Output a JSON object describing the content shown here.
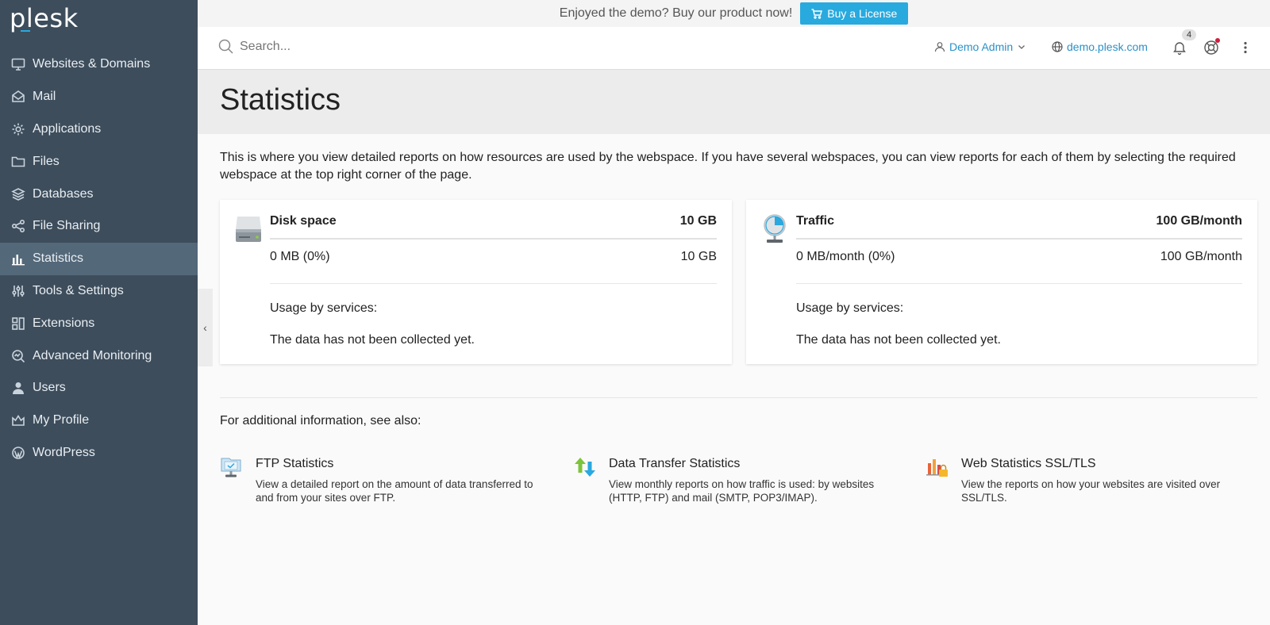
{
  "brand": {
    "logo": "plesk"
  },
  "sidebar": {
    "items": [
      {
        "label": "Websites & Domains",
        "icon": "monitor-icon",
        "active": false
      },
      {
        "label": "Mail",
        "icon": "mail-icon",
        "active": false
      },
      {
        "label": "Applications",
        "icon": "gear-icon",
        "active": false
      },
      {
        "label": "Files",
        "icon": "folder-icon",
        "active": false
      },
      {
        "label": "Databases",
        "icon": "layers-icon",
        "active": false
      },
      {
        "label": "File Sharing",
        "icon": "share-icon",
        "active": false
      },
      {
        "label": "Statistics",
        "icon": "bar-chart-icon",
        "active": true
      },
      {
        "label": "Tools & Settings",
        "icon": "sliders-icon",
        "active": false
      },
      {
        "label": "Extensions",
        "icon": "extensions-icon",
        "active": false
      },
      {
        "label": "Advanced Monitoring",
        "icon": "monitoring-icon",
        "active": false
      },
      {
        "label": "Users",
        "icon": "user-icon",
        "active": false
      },
      {
        "label": "My Profile",
        "icon": "crown-icon",
        "active": false
      },
      {
        "label": "WordPress",
        "icon": "wordpress-icon",
        "active": false
      }
    ]
  },
  "banner": {
    "text": "Enjoyed the demo? Buy our product now!",
    "button": "Buy a License"
  },
  "header": {
    "search_placeholder": "Search...",
    "user": "Demo Admin",
    "domain": "demo.plesk.com",
    "notifications_count": "4"
  },
  "page": {
    "title": "Statistics",
    "intro": "This is where you view detailed reports on how resources are used by the webspace. If you have several webspaces, you can view reports for each of them by selecting the required webspace at the top right corner of the page."
  },
  "cards": {
    "disk": {
      "title": "Disk space",
      "limit": "10 GB",
      "used": "0 MB (0%)",
      "used_limit": "10 GB",
      "usage_label": "Usage by services:",
      "no_data": "The data has not been collected yet."
    },
    "traffic": {
      "title": "Traffic",
      "limit": "100 GB/month",
      "used": "0 MB/month (0%)",
      "used_limit": "100 GB/month",
      "usage_label": "Usage by services:",
      "no_data": "The data has not been collected yet."
    }
  },
  "see_also": {
    "label": "For additional information, see also:",
    "links": [
      {
        "title": "FTP Statistics",
        "desc": "View a detailed report on the amount of data transferred to and from your sites over FTP.",
        "icon": "ftp-icon"
      },
      {
        "title": "Data Transfer Statistics",
        "desc": "View monthly reports on how traffic is used: by websites (HTTP, FTP) and mail (SMTP, POP3/IMAP).",
        "icon": "data-transfer-icon"
      },
      {
        "title": "Web Statistics SSL/TLS",
        "desc": "View the reports on how your websites are visited over SSL/TLS.",
        "icon": "web-stats-ssl-icon"
      }
    ]
  },
  "colors": {
    "sidebar": "#3d4d5c",
    "sidebar_active": "#536879",
    "accent": "#28aade",
    "link": "#2a91c8"
  }
}
